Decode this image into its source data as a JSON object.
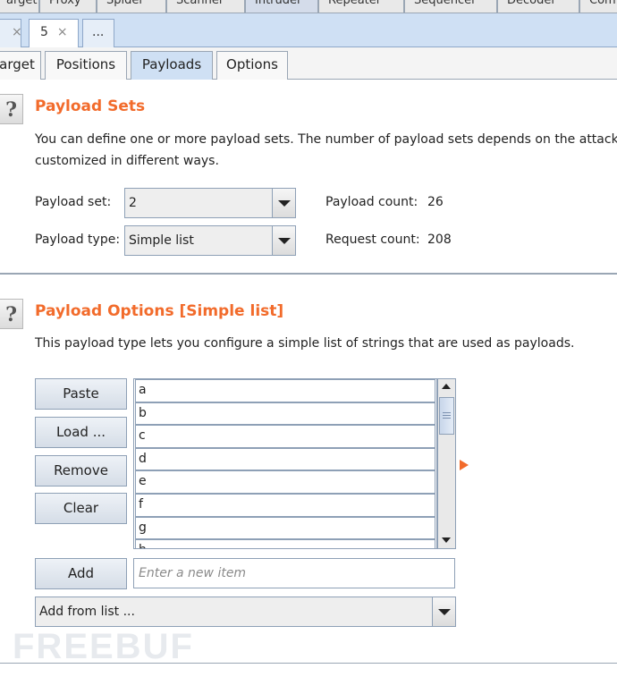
{
  "main_tabs": [
    "arget",
    "Proxy",
    "Spider",
    "Scanner",
    "Intruder",
    "Repeater",
    "Sequencer",
    "Decoder",
    "Com"
  ],
  "num_tabs": [
    {
      "label": "",
      "close": "×"
    },
    {
      "label": "5",
      "close": "×"
    },
    {
      "label": "...",
      "close": ""
    }
  ],
  "inner_tabs": [
    "arget",
    "Positions",
    "Payloads",
    "Options"
  ],
  "help_icon": "?",
  "payload_sets": {
    "title": "Payload Sets",
    "desc_line1": "You can define one or more payload sets. The number of payload sets depends on the attack",
    "desc_line2": "customized in different ways.",
    "set_label": "Payload set:",
    "set_value": "2",
    "type_label": "Payload type:",
    "type_value": "Simple list",
    "count_label": "Payload count:",
    "count_value": "26",
    "request_label": "Request count:",
    "request_value": "208"
  },
  "payload_options": {
    "title": "Payload Options [Simple list]",
    "desc": "This payload type lets you configure a simple list of strings that are used as payloads.",
    "buttons": {
      "paste": "Paste",
      "load": "Load ...",
      "remove": "Remove",
      "clear": "Clear",
      "add": "Add"
    },
    "items": [
      "a",
      "b",
      "c",
      "d",
      "e",
      "f",
      "g",
      "h"
    ],
    "new_item_placeholder": "Enter a new item",
    "add_from_list": "Add from list ..."
  },
  "watermark": "FREEBUF",
  "colors": {
    "accent": "#f26b2b",
    "tab_active": "#cfe0f4"
  }
}
